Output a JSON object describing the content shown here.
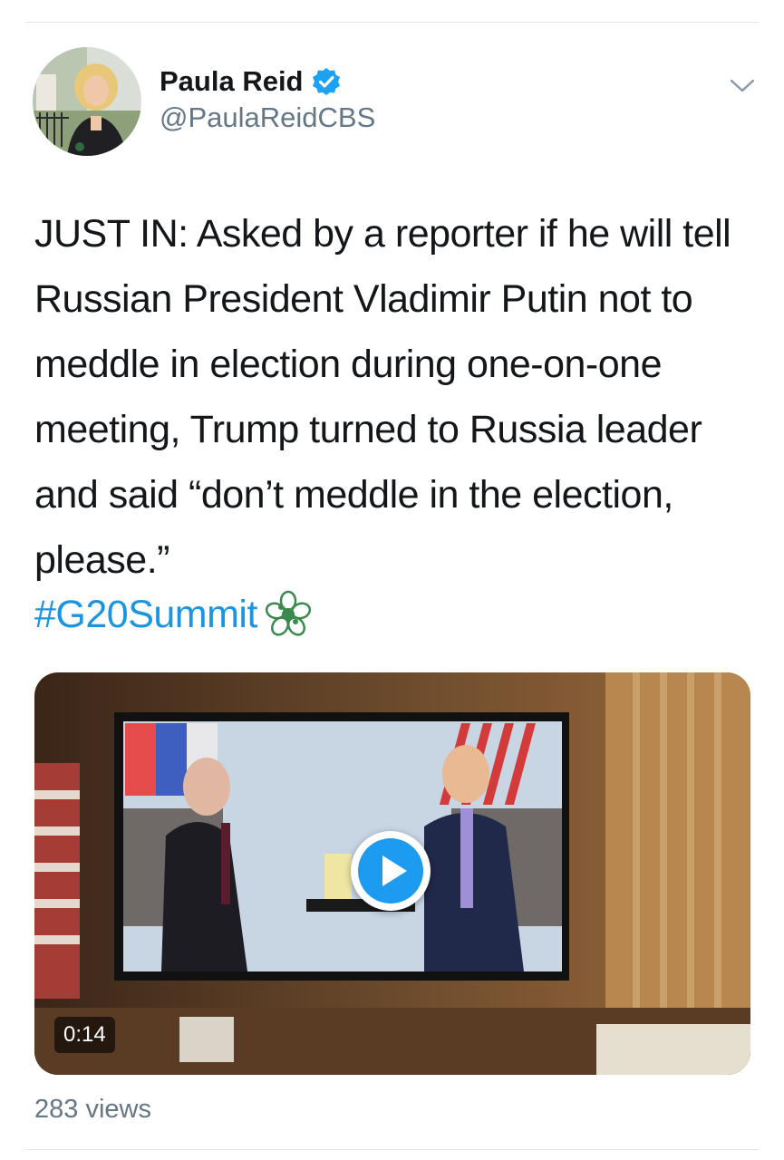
{
  "author": {
    "display_name": "Paula Reid",
    "handle": "@PaulaReidCBS",
    "verified": true
  },
  "tweet": {
    "text": "JUST IN: Asked by a reporter if he will tell Russian President Vladimir Putin not to meddle in election during one-on-one meeting, Trump turned to Russia leader and said “don’t meddle in the election, please.”",
    "hashtag": "#G20Summit"
  },
  "media": {
    "duration": "0:14",
    "views": "283 views"
  },
  "colors": {
    "link": "#1b95e0",
    "verified": "#1da1f2",
    "secondary_text": "#657786"
  },
  "icons": {
    "verified": "verified-badge-icon",
    "menu": "chevron-down-icon",
    "emoji": "g20-flower-emoji-icon",
    "play": "play-icon"
  }
}
